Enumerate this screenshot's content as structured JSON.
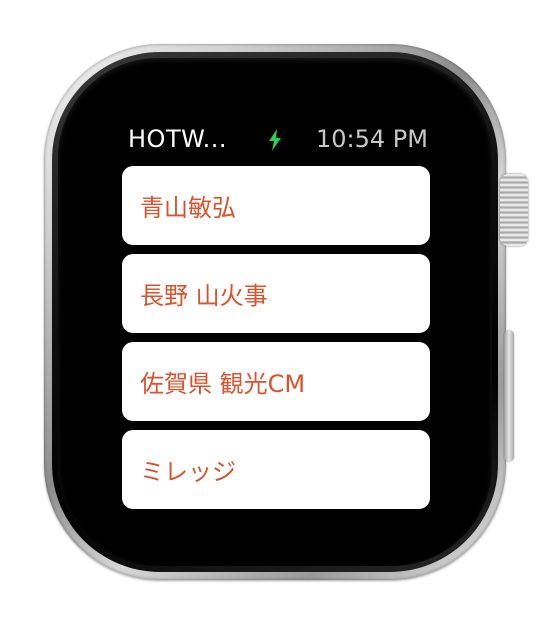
{
  "status_bar": {
    "app_title": "HOTW...",
    "charging_icon": "lightning-bolt-icon",
    "charging_color": "#2bd14f",
    "time": "10:54 PM"
  },
  "list": {
    "items": [
      {
        "label": "青山敏弘"
      },
      {
        "label": "長野 山火事"
      },
      {
        "label": "佐賀県 観光CM"
      },
      {
        "label": "ミレッジ"
      }
    ]
  },
  "colors": {
    "item_text": "#d9532c",
    "item_background": "#ffffff",
    "screen_background": "#000000"
  }
}
